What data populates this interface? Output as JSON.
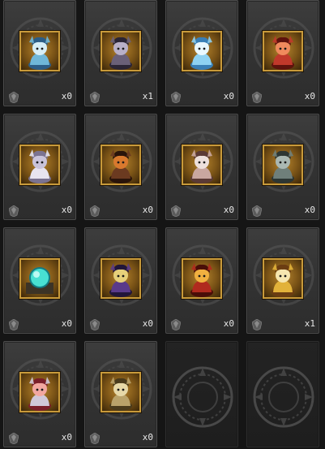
{
  "slots": [
    {
      "monster": "blue-dragon-girl-icon",
      "count": "x0",
      "palette": [
        "#6fb7d8",
        "#2c5d86",
        "#d6eef7"
      ]
    },
    {
      "monster": "armored-knight-icon",
      "count": "x1",
      "palette": [
        "#6a6078",
        "#2b2535",
        "#b9b0c8"
      ]
    },
    {
      "monster": "ice-spirit-icon",
      "count": "x0",
      "palette": [
        "#8fd2f2",
        "#3a7fb6",
        "#eaf8ff"
      ]
    },
    {
      "monster": "red-demon-icon",
      "count": "x0",
      "palette": [
        "#c0392b",
        "#5e130d",
        "#f08a5d"
      ]
    },
    {
      "monster": "white-haired-girl-icon",
      "count": "x0",
      "palette": [
        "#e8e4f0",
        "#7b7391",
        "#c9c3da"
      ]
    },
    {
      "monster": "dark-phoenix-icon",
      "count": "x0",
      "palette": [
        "#6b3a20",
        "#2a140a",
        "#d9792e"
      ]
    },
    {
      "monster": "skull-beast-icon",
      "count": "x0",
      "palette": [
        "#c9a7a0",
        "#5b3a35",
        "#ede0dc"
      ]
    },
    {
      "monster": "horned-golem-icon",
      "count": "x0",
      "palette": [
        "#6f7f7a",
        "#2d3633",
        "#aab8b3"
      ]
    },
    {
      "monster": "crystal-orb-icon",
      "count": "x0",
      "palette": [
        "#48e0d2",
        "#127a83",
        "#d9fffb"
      ]
    },
    {
      "monster": "witch-icon",
      "count": "x0",
      "palette": [
        "#5a3a8a",
        "#22163a",
        "#e6d07a"
      ]
    },
    {
      "monster": "red-beast-icon",
      "count": "x0",
      "palette": [
        "#b02a1e",
        "#4a0e08",
        "#f0b040"
      ]
    },
    {
      "monster": "golden-mask-icon",
      "count": "x1",
      "palette": [
        "#e2b23a",
        "#6b3d12",
        "#f6e6b0"
      ]
    },
    {
      "monster": "siren-icon",
      "count": "x0",
      "palette": [
        "#d0c8d8",
        "#7a1f2a",
        "#f2a7a0"
      ]
    },
    {
      "monster": "bone-dragon-icon",
      "count": "x0",
      "palette": [
        "#b9a26a",
        "#4a3b1c",
        "#e6d8a8"
      ]
    },
    {
      "monster": "empty-slot",
      "count": "",
      "palette": []
    },
    {
      "monster": "empty-slot",
      "count": "",
      "palette": []
    }
  ]
}
